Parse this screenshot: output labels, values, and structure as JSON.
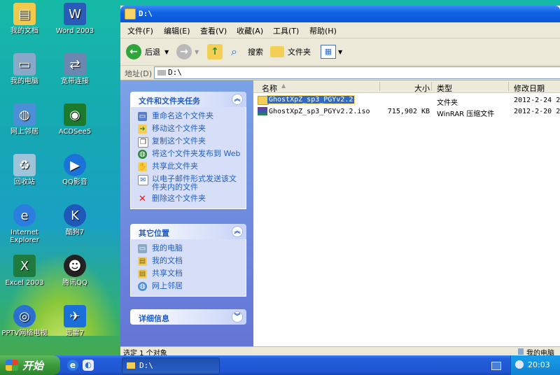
{
  "desktop": {
    "icons": [
      {
        "label": "我的文档",
        "icon": "folder-icon",
        "color": "#f2c94c"
      },
      {
        "label": "Word 2003",
        "icon": "word-icon",
        "color": "#2b5bb8"
      },
      {
        "label": "我的电脑",
        "icon": "computer-icon",
        "color": "#8aa8c8"
      },
      {
        "label": "宽带连接",
        "icon": "network-connection-icon",
        "color": "#6b87b0"
      },
      {
        "label": "网上邻居",
        "icon": "network-places-icon",
        "color": "#4c8fd6"
      },
      {
        "label": "ACDSee5",
        "icon": "acdsee-icon",
        "color": "#1c7a2c"
      },
      {
        "label": "回收站",
        "icon": "recycle-bin-icon",
        "color": "#9fc3d9"
      },
      {
        "label": "QQ影音",
        "icon": "qq-player-icon",
        "color": "#1a73d9"
      },
      {
        "label": "Internet Explorer",
        "icon": "ie-icon",
        "color": "#2b7de0"
      },
      {
        "label": "酷狗7",
        "icon": "kugou-icon",
        "color": "#1e58b8"
      },
      {
        "label": "Excel 2003",
        "icon": "excel-icon",
        "color": "#1f7a3d"
      },
      {
        "label": "腾讯QQ",
        "icon": "qq-icon",
        "color": "#222222"
      },
      {
        "label": "PPTV网络电视",
        "icon": "pptv-icon",
        "color": "#2b6fd0"
      },
      {
        "label": "迅雷7",
        "icon": "thunder-icon",
        "color": "#1b6fd8"
      }
    ]
  },
  "window": {
    "title": "D:\\",
    "menu": [
      "文件(F)",
      "编辑(E)",
      "查看(V)",
      "收藏(A)",
      "工具(T)",
      "帮助(H)"
    ],
    "toolbar": {
      "back": "后退",
      "search": "搜索",
      "folders": "文件夹"
    },
    "address": {
      "label": "地址(D)",
      "value": "D:\\"
    },
    "tasks_panel": {
      "title": "文件和文件夹任务",
      "items": [
        {
          "label": "重命名这个文件夹",
          "icon": "rename-icon"
        },
        {
          "label": "移动这个文件夹",
          "icon": "move-icon"
        },
        {
          "label": "复制这个文件夹",
          "icon": "copy-icon"
        },
        {
          "label": "将这个文件夹发布到 Web",
          "icon": "publish-web-icon"
        },
        {
          "label": "共享此文件夹",
          "icon": "share-icon"
        },
        {
          "label": "以电子邮件形式发送该文件夹内的文件",
          "icon": "email-icon"
        },
        {
          "label": "删除这个文件夹",
          "icon": "delete-icon"
        }
      ]
    },
    "places_panel": {
      "title": "其它位置",
      "items": [
        {
          "label": "我的电脑",
          "icon": "computer-icon"
        },
        {
          "label": "我的文档",
          "icon": "documents-icon"
        },
        {
          "label": "共享文档",
          "icon": "shared-docs-icon"
        },
        {
          "label": "网上邻居",
          "icon": "network-places-icon"
        }
      ]
    },
    "details_panel": {
      "title": "详细信息"
    },
    "columns": {
      "name": "名称",
      "size": "大小",
      "type": "类型",
      "modified": "修改日期"
    },
    "files": [
      {
        "name": "GhostXpZ_sp3_PGYv2.2",
        "size": "",
        "type": "文件夹",
        "modified": "2012-2-24 20:",
        "selected": true,
        "icon": "folder-icon"
      },
      {
        "name": "GhostXpZ_sp3_PGYv2.2.iso",
        "size": "715,902 KB",
        "type": "WinRAR 压缩文件",
        "modified": "2012-2-20 22:",
        "selected": false,
        "icon": "winrar-icon"
      }
    ],
    "status": {
      "left": "选定 1 个对象",
      "right": "我的电脑"
    }
  },
  "taskbar": {
    "start": "开始",
    "task": "D:\\",
    "clock": "20:03"
  }
}
